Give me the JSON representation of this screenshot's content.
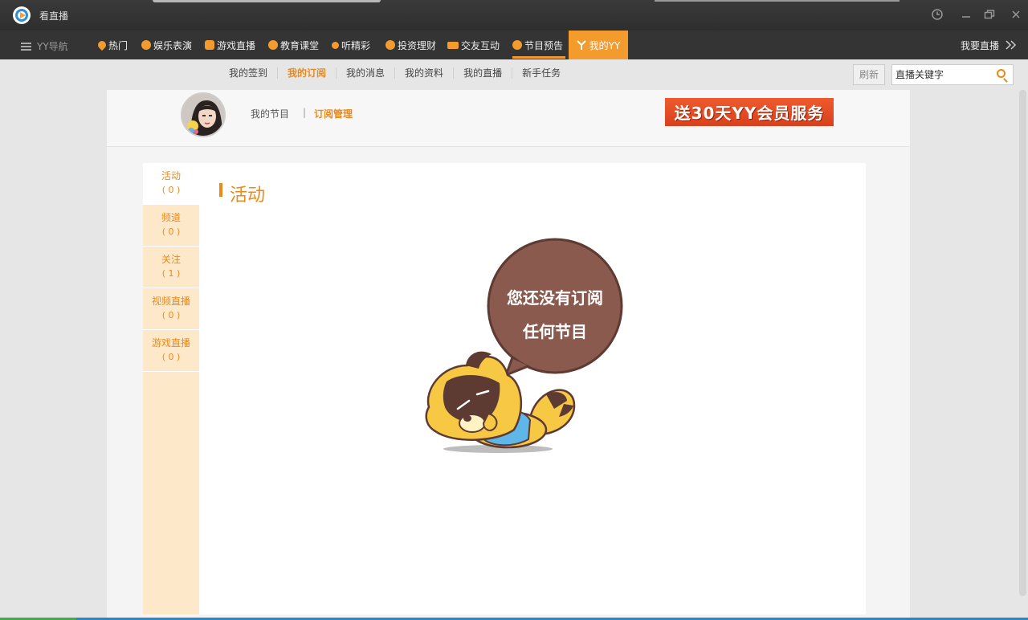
{
  "window": {
    "title": "看直播",
    "buttons": [
      "history-icon",
      "minimize-icon",
      "restore-icon",
      "close-icon"
    ]
  },
  "nav": {
    "guide_label": "YY导航",
    "items": [
      {
        "label": "热门",
        "icon": "flame-icon"
      },
      {
        "label": "娱乐表演",
        "icon": "smile-icon"
      },
      {
        "label": "游戏直播",
        "icon": "gamepad-icon"
      },
      {
        "label": "教育课堂",
        "icon": "book-icon"
      },
      {
        "label": "听精彩",
        "icon": "music-icon"
      },
      {
        "label": "投资理财",
        "icon": "finance-icon"
      },
      {
        "label": "交友互动",
        "icon": "friends-icon"
      },
      {
        "label": "节目预告",
        "icon": "schedule-icon"
      }
    ],
    "active_item": "我的YY",
    "go_live_label": "我要直播"
  },
  "subnav": {
    "items": [
      "我的签到",
      "我的订阅",
      "我的消息",
      "我的资料",
      "我的直播",
      "新手任务"
    ],
    "active": "我的订阅",
    "refresh_label": "刷新",
    "search_placeholder": "直播关键字"
  },
  "profile": {
    "my_programs": "我的节目",
    "separator": "|",
    "subscription_manage": "订阅管理",
    "promo_text": "送30天YY会员服务"
  },
  "sidebar": {
    "items": [
      {
        "label": "活动",
        "count": "( 0 )"
      },
      {
        "label": "频道",
        "count": "( 0 )"
      },
      {
        "label": "关注",
        "count": "( 1 )"
      },
      {
        "label": "视频直播",
        "count": "( 0 )"
      },
      {
        "label": "游戏直播",
        "count": "( 0 )"
      }
    ],
    "active_index": 0
  },
  "main": {
    "section_title": "活动",
    "empty_line1": "您还没有订阅",
    "empty_line2": "任何节目"
  },
  "colors": {
    "accent": "#f39b2d",
    "accent_text": "#e98a1c",
    "sidebar_bg": "#fde9c9",
    "bubble": "#8b5a4e"
  }
}
